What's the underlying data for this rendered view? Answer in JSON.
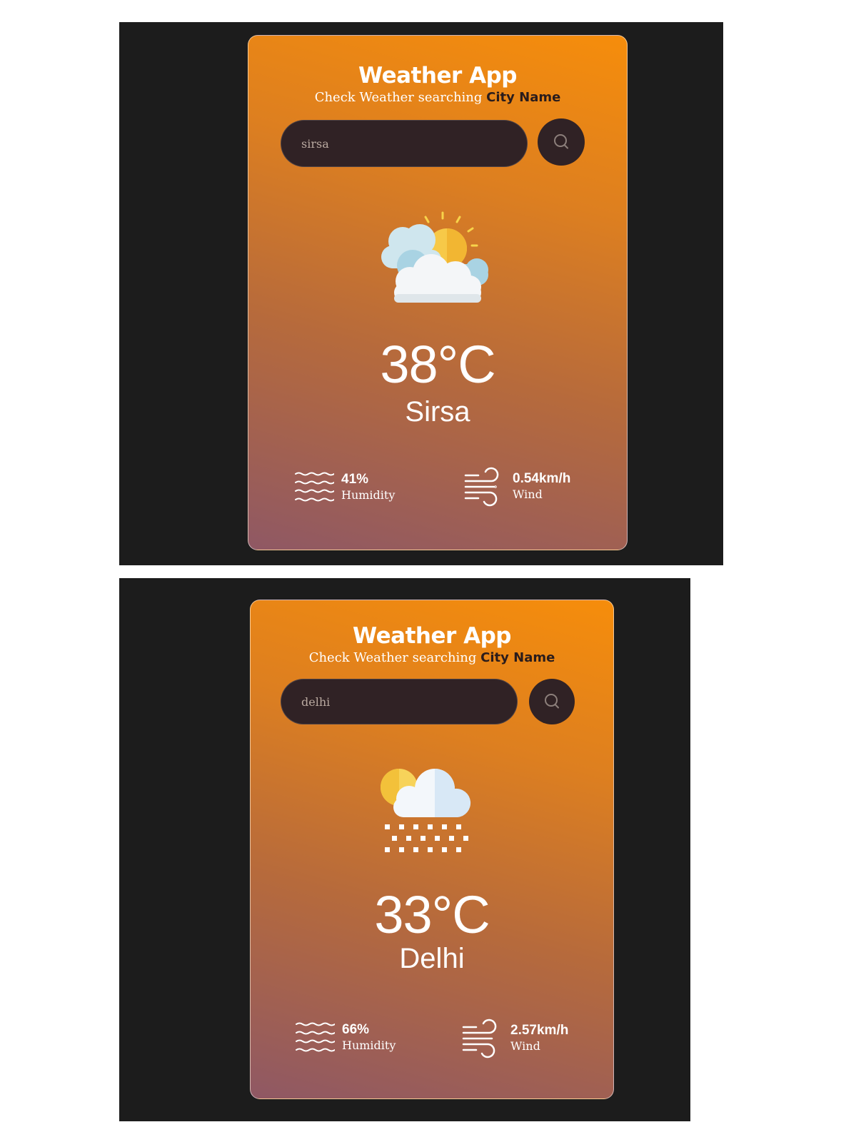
{
  "screenshots": [
    {
      "title": "Weather App",
      "subtitle_prefix": "Check Weather searching ",
      "subtitle_accent": "City Name",
      "search_value": "sirsa",
      "weather_icon": "sun-behind-clouds-icon",
      "temperature": "38°C",
      "city": "Sirsa",
      "humidity_value": "41%",
      "humidity_label": "Humidity",
      "wind_value": "0.54km/h",
      "wind_label": "Wind"
    },
    {
      "title": "Weather App",
      "subtitle_prefix": "Check Weather searching ",
      "subtitle_accent": "City Name",
      "search_value": "delhi",
      "weather_icon": "snow-cloud-icon",
      "temperature": "33°C",
      "city": "Delhi",
      "humidity_value": "66%",
      "humidity_label": "Humidity",
      "wind_value": "2.57km/h",
      "wind_label": "Wind"
    }
  ],
  "colors": {
    "page_background": "#1c1c1c",
    "card_gradient_top": "#f68d0b",
    "card_gradient_bottom": "#8f5864",
    "search_background": "#302225",
    "accent_text": "#2a1c1c"
  }
}
